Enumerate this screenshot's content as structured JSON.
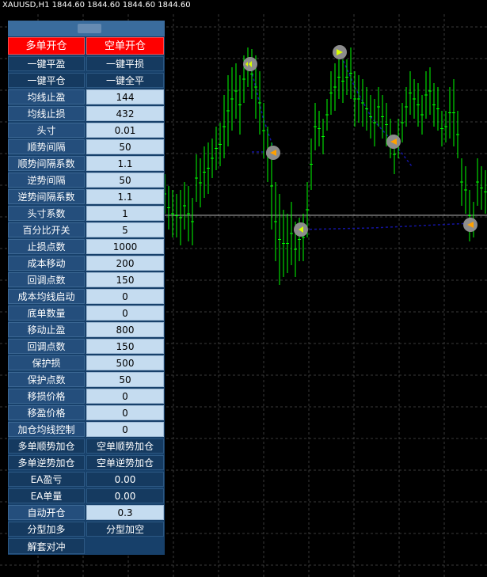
{
  "window": {
    "symbol": "XAUUSD,H1",
    "quotes": "1844.60 1844.60 1844.60 1844.60"
  },
  "panel": {
    "order_buttons": {
      "buy": "多单开仓",
      "sell": "空单开仓"
    },
    "action_rows": [
      {
        "left": "一键平盈",
        "right": "一键平损"
      },
      {
        "left": "一键平仓",
        "right": "一键全平"
      }
    ],
    "params": [
      {
        "label": "均线止盈",
        "value": "144"
      },
      {
        "label": "均线止损",
        "value": "432"
      },
      {
        "label": "头寸",
        "value": "0.01"
      },
      {
        "label": "顺势间隔",
        "value": "50"
      },
      {
        "label": "顺势间隔系数",
        "value": "1.1"
      },
      {
        "label": "逆势间隔",
        "value": "50"
      },
      {
        "label": "逆势间隔系数",
        "value": "1.1"
      },
      {
        "label": "头寸系数",
        "value": "1"
      },
      {
        "label": "百分比开关",
        "value": "5"
      },
      {
        "label": "止损点数",
        "value": "1000"
      },
      {
        "label": "成本移动",
        "value": "200"
      },
      {
        "label": "回调点数",
        "value": "150"
      },
      {
        "label": "成本均线启动",
        "value": "0"
      },
      {
        "label": "底单数量",
        "value": "0"
      },
      {
        "label": "移动止盈",
        "value": "800"
      },
      {
        "label": "回调点数",
        "value": "150"
      },
      {
        "label": "保护损",
        "value": "500"
      },
      {
        "label": "保护点数",
        "value": "50"
      },
      {
        "label": "移损价格",
        "value": "0"
      },
      {
        "label": "移盈价格",
        "value": "0"
      },
      {
        "label": "加仓均线控制",
        "value": "0"
      }
    ],
    "add_buttons": [
      {
        "left": "多单顺势加仓",
        "right": "空单顺势加仓"
      },
      {
        "left": "多单逆势加仓",
        "right": "空单逆势加仓"
      }
    ],
    "stats": [
      {
        "label": "EA盈亏",
        "value": "0.00"
      },
      {
        "label": "EA单量",
        "value": "0.00"
      }
    ],
    "auto_open": {
      "label": "自动开仓",
      "value": "0.3"
    },
    "split_buttons": {
      "left": "分型加多",
      "right": "分型加空"
    },
    "unlock_button": "解套对冲"
  },
  "colors": {
    "background": "#000000",
    "grid": "#3a3a3a",
    "candle": "#00ff00",
    "price_line": "#b4b4b4",
    "trade_line": "#1414a0",
    "marker": "#8c8c8c",
    "red": "#ff0000"
  }
}
